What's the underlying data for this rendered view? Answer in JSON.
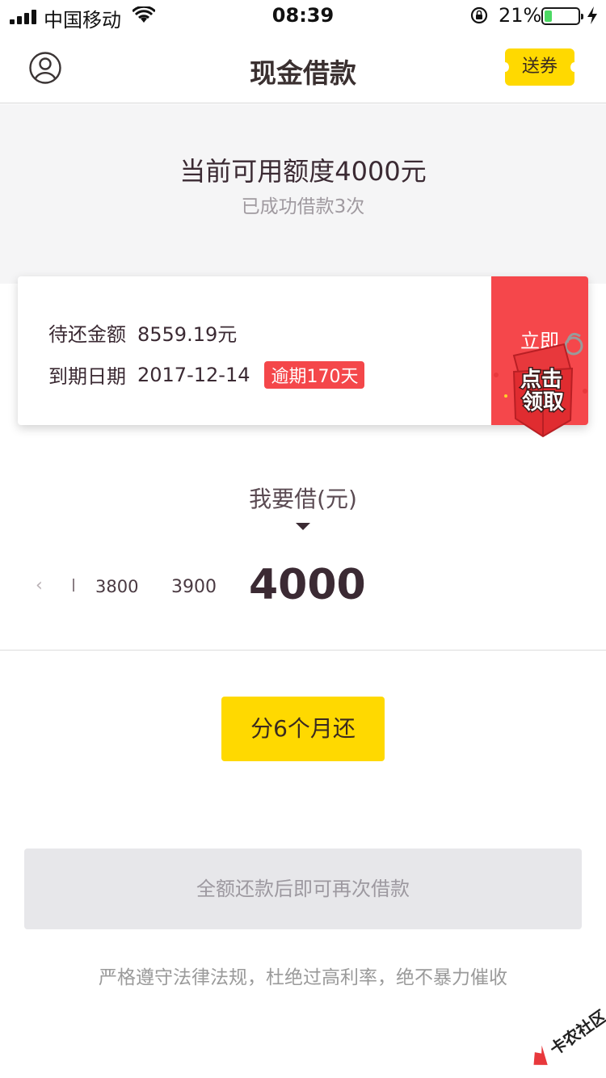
{
  "status_bar": {
    "carrier": "中国移动",
    "time": "08:39",
    "battery_percent": "21%",
    "battery_level": 0.21
  },
  "nav": {
    "title": "现金借款",
    "coupon_label": "送券"
  },
  "credit": {
    "title": "当前可用额度4000元",
    "subtitle": "已成功借款3次"
  },
  "repay": {
    "amount_label": "待还金额",
    "amount_value": "8559.19元",
    "due_label": "到期日期",
    "due_value": "2017-12-14",
    "overdue_badge": "逾期170天",
    "repay_button": "立即",
    "gift_text_1": "点击",
    "gift_text_2": "领取"
  },
  "borrow": {
    "label": "我要借(元)",
    "options": [
      "3800",
      "3900"
    ],
    "selected": "4000"
  },
  "installment": {
    "label": "分6个月还"
  },
  "notice": {
    "disabled_text": "全额还款后即可再次借款",
    "footer": "严格遵守法律法规，杜绝过高利率，绝不暴力催收"
  },
  "watermark": {
    "text": "卡农社区"
  },
  "colors": {
    "accent": "#ffd900",
    "alert": "#f4474a",
    "text": "#3b2a33"
  }
}
